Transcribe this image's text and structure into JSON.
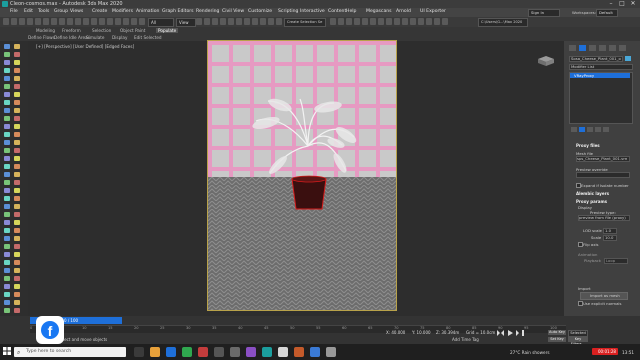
{
  "window": {
    "title": "Cleon-cosmos.max - Autodesk 3ds Max 2020",
    "controls": [
      "–",
      "□",
      "✕"
    ]
  },
  "menu": [
    "File",
    "Edit",
    "Tools",
    "Group",
    "Views",
    "Create",
    "Modifiers",
    "Animation",
    "Graph Editors",
    "Rendering",
    "Civil View",
    "Customize",
    "Scripting",
    "Interactive",
    "Content",
    "Help",
    "Megascans",
    "Arnold",
    "UI Exporter"
  ],
  "toolbar": {
    "selection_filter": "All",
    "view_dropdown": "View",
    "selection_set": "Create Selection Se",
    "workspace": "C:\\Users\\G...\\Max 2020",
    "signin": "Sign In",
    "workspaces": "Workspaces:",
    "workspace_value": "Default"
  },
  "ribbon": {
    "tabs": [
      "Modeling",
      "Freeform",
      "Selection",
      "Object Paint",
      "Populate"
    ],
    "subtabs": [
      "Define Flows",
      "Define Idle Areas",
      "Simulate",
      "Display",
      "Edit Selected"
    ]
  },
  "viewport": {
    "label": "[+] [Perspective] [User Defined] [Edged Faces]"
  },
  "right_panel": {
    "object_name": "Sosa_Cheese_Plant_001_obj_...",
    "modifier_list": "Modifier List",
    "stack_item": "VRayProxy",
    "sections": {
      "proxy_files": "Proxy files",
      "mesh_file_label": "Mesh file",
      "mesh_file_value": "sps_Cheese_Plant_001.vrmesh",
      "preview_override": "Preview override",
      "expand": "Expand if Isolate number",
      "alembic_layers": "Alembic layers",
      "proxy_params": "Proxy params",
      "display": "Display",
      "preview_type": "Preview type:",
      "preview_type_value": "preview from file (proxy)",
      "lod_scale": "LOD scale",
      "lod_value": "1.0",
      "scale": "Scale",
      "scale_value": "10.0",
      "flip_axis": "Flip axis",
      "animation": "Animation",
      "playback": "Playback",
      "loop": "Loop",
      "import": "Import",
      "import_as_mesh": "Import as mesh",
      "use_explicit_normals": "Use explicit normals"
    }
  },
  "timeline": {
    "frame": "0 / 100",
    "ticks": [
      "0",
      "5",
      "10",
      "15",
      "20",
      "25",
      "30",
      "35",
      "40",
      "45",
      "50",
      "55",
      "60",
      "65",
      "70",
      "75",
      "80",
      "85",
      "90",
      "95",
      "100"
    ],
    "status": "Click or click-and-drag to select objects",
    "prompt": "Select and move objects",
    "coords": {
      "x": "X: 40.000",
      "y": "Y: 10.000",
      "z": "Z: 30.394m"
    },
    "grid": "Grid = 10.0cm",
    "add_time_tag": "Add Time Tag",
    "autokey": "Auto Key",
    "selected": "Selected",
    "set_key": "Set Key",
    "key_filters": "Key Filters..."
  },
  "taskbar": {
    "search_placeholder": "Type here to search",
    "weather": "27°C Rain showers",
    "rec": "00:01:28",
    "time": "13:51"
  },
  "colors": {
    "accent_blue": "#1e6fd9",
    "facebook_blue": "#1877f2",
    "wall_pink": "#e69ac2",
    "rec_red": "#d92020"
  }
}
